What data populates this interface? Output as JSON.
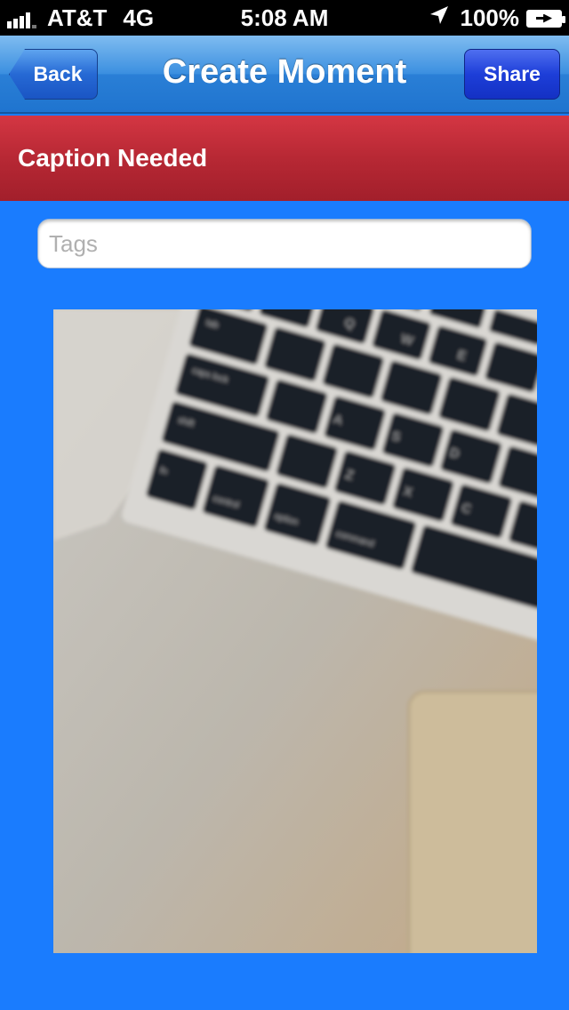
{
  "status_bar": {
    "carrier": "AT&T",
    "network": "4G",
    "time": "5:08 AM",
    "battery": "100%",
    "icons": [
      "signal-icon",
      "location-arrow-icon",
      "battery-charging-icon"
    ]
  },
  "nav": {
    "title": "Create Moment",
    "back_label": "Back",
    "share_label": "Share"
  },
  "caption_banner": {
    "text": "Caption Needed"
  },
  "tags": {
    "placeholder": "Tags",
    "value": ""
  },
  "photo": {
    "subject": "laptop-keyboard-photo"
  },
  "colors": {
    "background": "#1a7cfe",
    "nav_bar": "#2a7fd6",
    "banner": "#b72834",
    "share_button": "#1d3ed8"
  }
}
